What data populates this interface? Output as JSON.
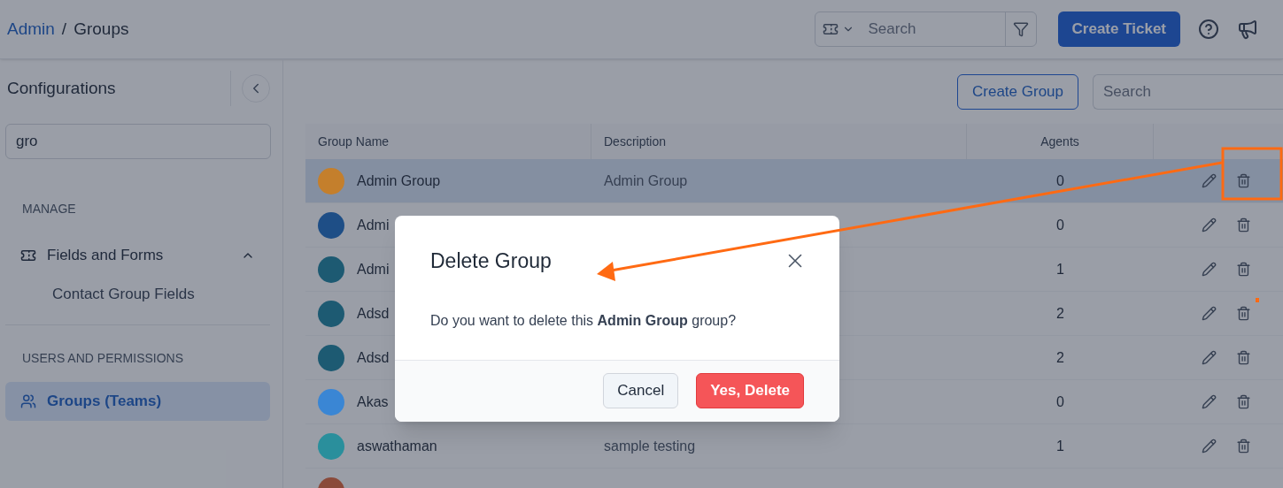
{
  "breadcrumb": {
    "parent": "Admin",
    "separator": "/",
    "current": "Groups"
  },
  "header": {
    "search_placeholder": "Search",
    "create_button": "Create Ticket"
  },
  "sidebar": {
    "title": "Configurations",
    "search_value": "gro",
    "sections": [
      {
        "heading": "MANAGE",
        "items": [
          {
            "label": "Fields and Forms",
            "selected": false,
            "expanded": true,
            "children": [
              {
                "label": "Contact Group Fields",
                "selected": false
              }
            ]
          }
        ]
      },
      {
        "heading": "USERS AND PERMISSIONS",
        "items": [
          {
            "label": "Groups (Teams)",
            "selected": true
          }
        ]
      }
    ]
  },
  "toolbar": {
    "create_button": "Create Group",
    "search_placeholder": "Search"
  },
  "table": {
    "columns": [
      "Group Name",
      "Description",
      "Agents"
    ],
    "rows": [
      {
        "name": "Admin Group",
        "description": "Admin Group",
        "agents": "0",
        "color": "#c47f2c",
        "selected": true
      },
      {
        "name": "Admi",
        "agents": "0",
        "color": "#1e4e86",
        "selected": false
      },
      {
        "name": "Admi",
        "agents": "1",
        "color": "#1d5a72",
        "selected": false
      },
      {
        "name": "Adsd",
        "agents": "2",
        "color": "#1d5a72",
        "selected": false
      },
      {
        "name": "Adsd",
        "agents": "2",
        "color": "#1d5a72",
        "selected": false
      },
      {
        "name": "Akas",
        "agents": "0",
        "color": "#3a86d4",
        "selected": false
      },
      {
        "name": "aswathaman",
        "description": "sample testing",
        "agents": "1",
        "color": "#2a8f9c",
        "selected": false
      },
      {
        "color": "#8a4a3a",
        "selected": false
      }
    ]
  },
  "dialog": {
    "title": "Delete Group",
    "message": "Do you want to delete this **Admin Group** group?",
    "cancel": "Cancel",
    "confirm": "Yes, Delete"
  }
}
